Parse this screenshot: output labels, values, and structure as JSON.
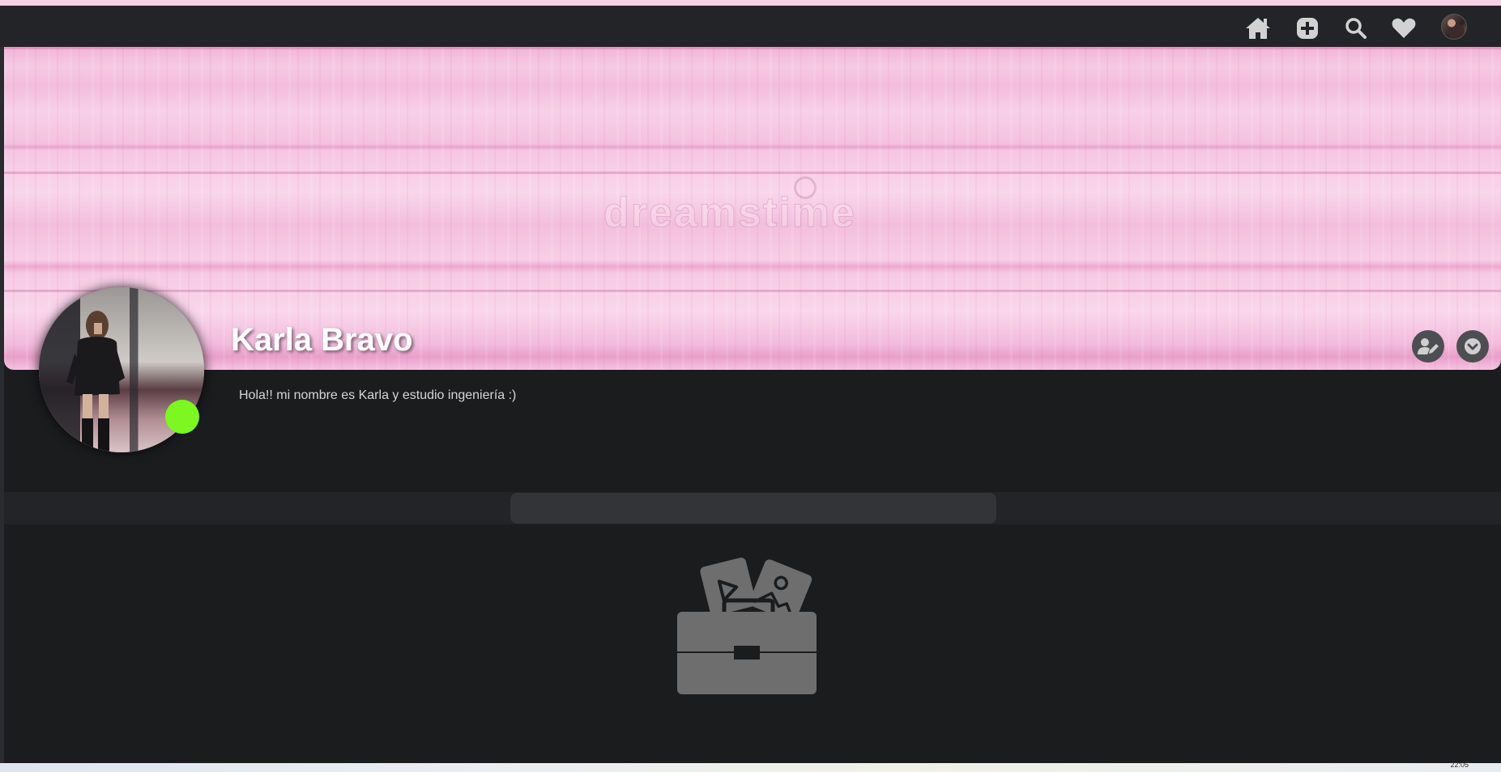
{
  "topbar": {
    "icons": [
      {
        "name": "home-icon"
      },
      {
        "name": "add-icon"
      },
      {
        "name": "search-icon"
      },
      {
        "name": "heart-icon"
      }
    ],
    "avatar": "user-avatar"
  },
  "banner": {
    "watermark": "dreamstime"
  },
  "profile": {
    "name": "Karla Bravo",
    "bio": "Hola!! mi nombre es Karla y estudio ingeniería :)",
    "status_color": "#7cf721",
    "status": "online"
  },
  "actions": {
    "edit_icon": "edit-profile-icon",
    "more_icon": "chevron-down-icon"
  },
  "empty_state": {
    "icon": "briefcase-media-icon"
  },
  "taskbar": {
    "clock": "22:05"
  },
  "colors": {
    "background": "#1b1c1e",
    "topbar": "#232427",
    "banner_pink": "#f6c9e4",
    "icon_gray": "#d2d2d2",
    "status_green": "#7cf721"
  }
}
